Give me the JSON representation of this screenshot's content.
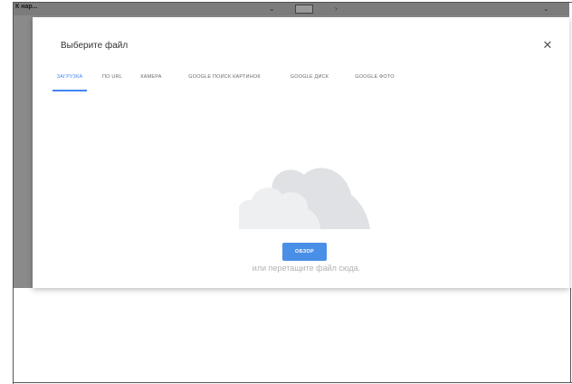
{
  "background_window": {
    "title": "К нар..."
  },
  "dialog": {
    "title": "Выберите файл",
    "close_glyph": "✕",
    "tabs": [
      {
        "label": "ЗАГРУЗКА",
        "active": true
      },
      {
        "label": "ПО URL",
        "active": false
      },
      {
        "label": "КАМЕРА",
        "active": false
      },
      {
        "label": "GOOGLE ПОИСК КАРТИНОК",
        "active": false
      },
      {
        "label": "GOOGLE ДИСК",
        "active": false
      },
      {
        "label": "GOOGLE ФОТО",
        "active": false
      }
    ],
    "upload": {
      "cloud_icon": "cloud-icon",
      "browse_label": "ОБЗОР",
      "drop_hint": "или перетащите файл сюда."
    }
  },
  "colors": {
    "accent": "#4285f4",
    "button": "#4a8fe7",
    "backdrop": "#8a8a8a",
    "cloud": "#e6e7e9"
  }
}
